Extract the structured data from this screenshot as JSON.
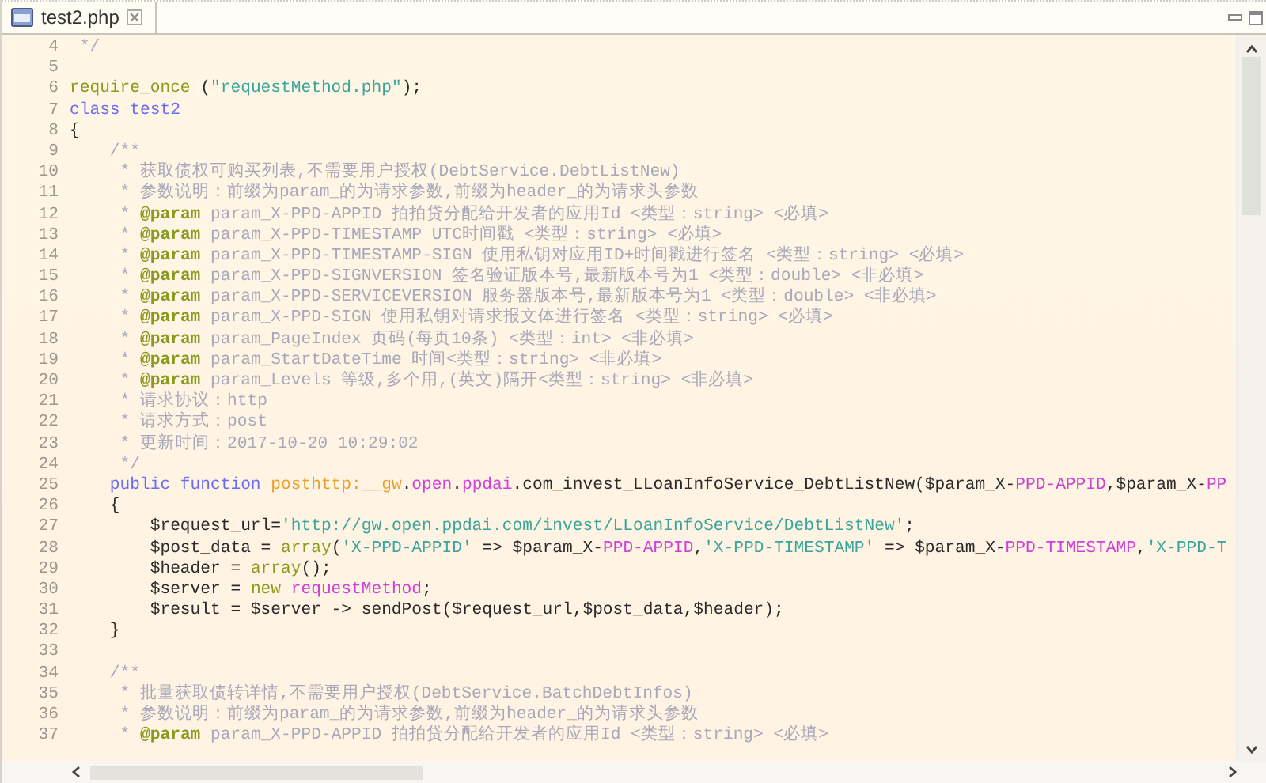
{
  "tab": {
    "label": "test2.php",
    "selected": true
  },
  "lines": [
    {
      "number": "4",
      "tokens": [
        {
          "kind": "comment",
          "text": " */"
        }
      ]
    },
    {
      "number": "5"
    },
    {
      "number": "6",
      "tokens": [
        {
          "kind": "builtin",
          "text": "require_once"
        },
        {
          "kind": "plain",
          "text": " ("
        },
        {
          "kind": "string",
          "text": "\"requestMethod.php\""
        },
        {
          "kind": "plain",
          "text": ");"
        }
      ]
    },
    {
      "number": "7",
      "tokens": [
        {
          "kind": "keyword",
          "text": "class test2"
        }
      ]
    },
    {
      "number": "8",
      "tokens": [
        {
          "kind": "plain",
          "text": "{"
        }
      ]
    },
    {
      "number": "9",
      "tokens": [
        {
          "kind": "comment",
          "text": "    /**"
        }
      ]
    },
    {
      "number": "10",
      "tokens": [
        {
          "kind": "comment",
          "text": "     * 获取债权可购买列表,不需要用户授权(DebtService.DebtListNew)"
        }
      ]
    },
    {
      "number": "11",
      "tokens": [
        {
          "kind": "comment",
          "text": "     * 参数说明：前缀为param_的为请求参数,前缀为header_的为请求头参数"
        }
      ]
    },
    {
      "number": "12",
      "tokens": [
        {
          "kind": "comment",
          "text": "     * "
        },
        {
          "kind": "doctag",
          "text": "@param"
        },
        {
          "kind": "comment",
          "text": " param_X-PPD-APPID 拍拍贷分配给开发者的应用Id <类型：string> <必填>"
        }
      ]
    },
    {
      "number": "13",
      "tokens": [
        {
          "kind": "comment",
          "text": "     * "
        },
        {
          "kind": "doctag",
          "text": "@param"
        },
        {
          "kind": "comment",
          "text": " param_X-PPD-TIMESTAMP UTC时间戳 <类型：string> <必填>"
        }
      ]
    },
    {
      "number": "14",
      "tokens": [
        {
          "kind": "comment",
          "text": "     * "
        },
        {
          "kind": "doctag",
          "text": "@param"
        },
        {
          "kind": "comment",
          "text": " param_X-PPD-TIMESTAMP-SIGN 使用私钥对应用ID+时间戳进行签名 <类型：string> <必填>"
        }
      ]
    },
    {
      "number": "15",
      "tokens": [
        {
          "kind": "comment",
          "text": "     * "
        },
        {
          "kind": "doctag",
          "text": "@param"
        },
        {
          "kind": "comment",
          "text": " param_X-PPD-SIGNVERSION 签名验证版本号,最新版本号为1 <类型：double> <非必填>"
        }
      ]
    },
    {
      "number": "16",
      "tokens": [
        {
          "kind": "comment",
          "text": "     * "
        },
        {
          "kind": "doctag",
          "text": "@param"
        },
        {
          "kind": "comment",
          "text": " param_X-PPD-SERVICEVERSION 服务器版本号,最新版本号为1 <类型：double> <非必填>"
        }
      ]
    },
    {
      "number": "17",
      "tokens": [
        {
          "kind": "comment",
          "text": "     * "
        },
        {
          "kind": "doctag",
          "text": "@param"
        },
        {
          "kind": "comment",
          "text": " param_X-PPD-SIGN 使用私钥对请求报文体进行签名 <类型：string> <必填>"
        }
      ]
    },
    {
      "number": "18",
      "tokens": [
        {
          "kind": "comment",
          "text": "     * "
        },
        {
          "kind": "doctag",
          "text": "@param"
        },
        {
          "kind": "comment",
          "text": " param_PageIndex 页码(每页10条) <类型：int> <非必填>"
        }
      ]
    },
    {
      "number": "19",
      "tokens": [
        {
          "kind": "comment",
          "text": "     * "
        },
        {
          "kind": "doctag",
          "text": "@param"
        },
        {
          "kind": "comment",
          "text": " param_StartDateTime 时间<类型：string> <非必填>"
        }
      ]
    },
    {
      "number": "20",
      "tokens": [
        {
          "kind": "comment",
          "text": "     * "
        },
        {
          "kind": "doctag",
          "text": "@param"
        },
        {
          "kind": "comment",
          "text": " param_Levels 等级,多个用,(英文)隔开<类型：string> <非必填>"
        }
      ]
    },
    {
      "number": "21",
      "tokens": [
        {
          "kind": "comment",
          "text": "     * 请求协议：http"
        }
      ]
    },
    {
      "number": "22",
      "tokens": [
        {
          "kind": "comment",
          "text": "     * 请求方式：post"
        }
      ]
    },
    {
      "number": "23",
      "tokens": [
        {
          "kind": "comment",
          "text": "     * 更新时间：2017-10-20 10:29:02"
        }
      ]
    },
    {
      "number": "24",
      "tokens": [
        {
          "kind": "comment",
          "text": "     */"
        }
      ]
    },
    {
      "number": "25",
      "tokens": [
        {
          "kind": "keyword",
          "text": "    public function "
        },
        {
          "kind": "function",
          "text": "posthttp:__gw"
        },
        {
          "kind": "plain",
          "text": "."
        },
        {
          "kind": "constant",
          "text": "open"
        },
        {
          "kind": "plain",
          "text": "."
        },
        {
          "kind": "constant",
          "text": "ppdai"
        },
        {
          "kind": "plain",
          "text": ".com_invest_LLoanInfoService_DebtListNew($param_X-"
        },
        {
          "kind": "constant",
          "text": "PPD-APPID"
        },
        {
          "kind": "plain",
          "text": ",$param_X-"
        },
        {
          "kind": "constant",
          "text": "PP"
        }
      ]
    },
    {
      "number": "26",
      "tokens": [
        {
          "kind": "plain",
          "text": "    {"
        }
      ]
    },
    {
      "number": "27",
      "tokens": [
        {
          "kind": "plain",
          "text": "        $request_url="
        },
        {
          "kind": "string",
          "text": "'http://gw.open.ppdai.com/invest/LLoanInfoService/DebtListNew'"
        },
        {
          "kind": "plain",
          "text": ";"
        }
      ]
    },
    {
      "number": "28",
      "tokens": [
        {
          "kind": "plain",
          "text": "        $post_data = "
        },
        {
          "kind": "builtin",
          "text": "array"
        },
        {
          "kind": "plain",
          "text": "("
        },
        {
          "kind": "string",
          "text": "'X-PPD-APPID'"
        },
        {
          "kind": "plain",
          "text": " => $param_X-"
        },
        {
          "kind": "constant",
          "text": "PPD-APPID"
        },
        {
          "kind": "plain",
          "text": ","
        },
        {
          "kind": "string",
          "text": "'X-PPD-TIMESTAMP'"
        },
        {
          "kind": "plain",
          "text": " => $param_X-"
        },
        {
          "kind": "constant",
          "text": "PPD-TIMESTAMP"
        },
        {
          "kind": "plain",
          "text": ","
        },
        {
          "kind": "string",
          "text": "'X-PPD-T"
        }
      ]
    },
    {
      "number": "29",
      "tokens": [
        {
          "kind": "plain",
          "text": "        $header = "
        },
        {
          "kind": "builtin",
          "text": "array"
        },
        {
          "kind": "plain",
          "text": "();"
        }
      ]
    },
    {
      "number": "30",
      "tokens": [
        {
          "kind": "plain",
          "text": "        $server = "
        },
        {
          "kind": "builtin",
          "text": "new "
        },
        {
          "kind": "constant",
          "text": "requestMethod"
        },
        {
          "kind": "plain",
          "text": ";"
        }
      ]
    },
    {
      "number": "31",
      "tokens": [
        {
          "kind": "plain",
          "text": "        $result = $server -> sendPost($request_url,$post_data,$header);"
        }
      ]
    },
    {
      "number": "32",
      "tokens": [
        {
          "kind": "plain",
          "text": "    }"
        }
      ]
    },
    {
      "number": "33"
    },
    {
      "number": "34",
      "tokens": [
        {
          "kind": "comment",
          "text": "    /**"
        }
      ]
    },
    {
      "number": "35",
      "tokens": [
        {
          "kind": "comment",
          "text": "     * 批量获取债转详情,不需要用户授权(DebtService.BatchDebtInfos)"
        }
      ]
    },
    {
      "number": "36",
      "tokens": [
        {
          "kind": "comment",
          "text": "     * 参数说明：前缀为param_的为请求参数,前缀为header_的为请求头参数"
        }
      ]
    },
    {
      "number": "37",
      "tokens": [
        {
          "kind": "comment",
          "text": "     * "
        },
        {
          "kind": "doctag",
          "text": "@param"
        },
        {
          "kind": "comment",
          "text": " param_X-PPD-APPID 拍拍贷分配给开发者的应用Id <类型：string> <必填>"
        }
      ]
    }
  ]
}
